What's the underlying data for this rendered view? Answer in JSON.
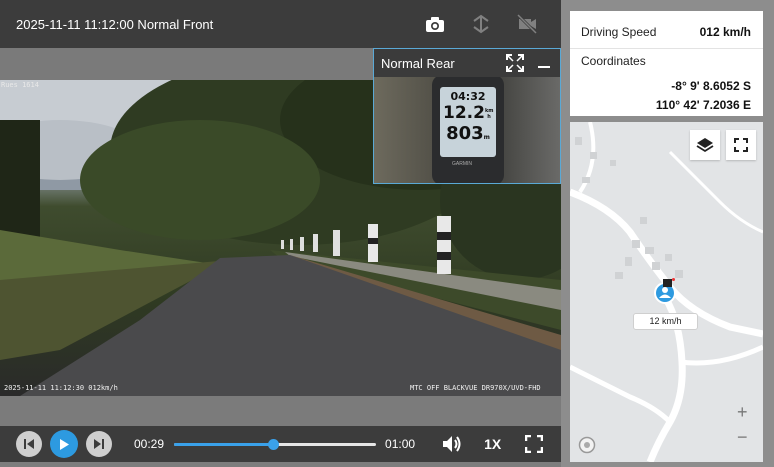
{
  "video": {
    "title": "2025-11-11 11:12:00 Normal Front",
    "osd_top": "Rues 1614",
    "osd_bottom_left": "2025-11-11 11:12:30 012km/h",
    "osd_bottom_right": "MTC  OFF  BLACKVUE DR970X/UVD-FHD"
  },
  "pip": {
    "title": "Normal Rear",
    "gps_time": "04:32",
    "gps_speed": "12.2",
    "gps_speed_unit": "km h",
    "gps_distance": "803",
    "gps_distance_unit": "m",
    "gps_brand": "GARMIN"
  },
  "controls": {
    "current_time": "00:29",
    "total_time": "01:00",
    "progress": 0.49,
    "playback_speed": "1X"
  },
  "info": {
    "speed_label": "Driving Speed",
    "speed_value": "012 km/h",
    "coords_label": "Coordinates",
    "latitude": "-8° 9' 8.6052 S",
    "longitude": "110° 42' 7.2036 E"
  },
  "map": {
    "marker_speed": "12 km/h",
    "zoom_in": "+",
    "zoom_out": "−"
  },
  "colors": {
    "accent": "#2d9ae0",
    "panel_dark": "#3c3c3c"
  }
}
